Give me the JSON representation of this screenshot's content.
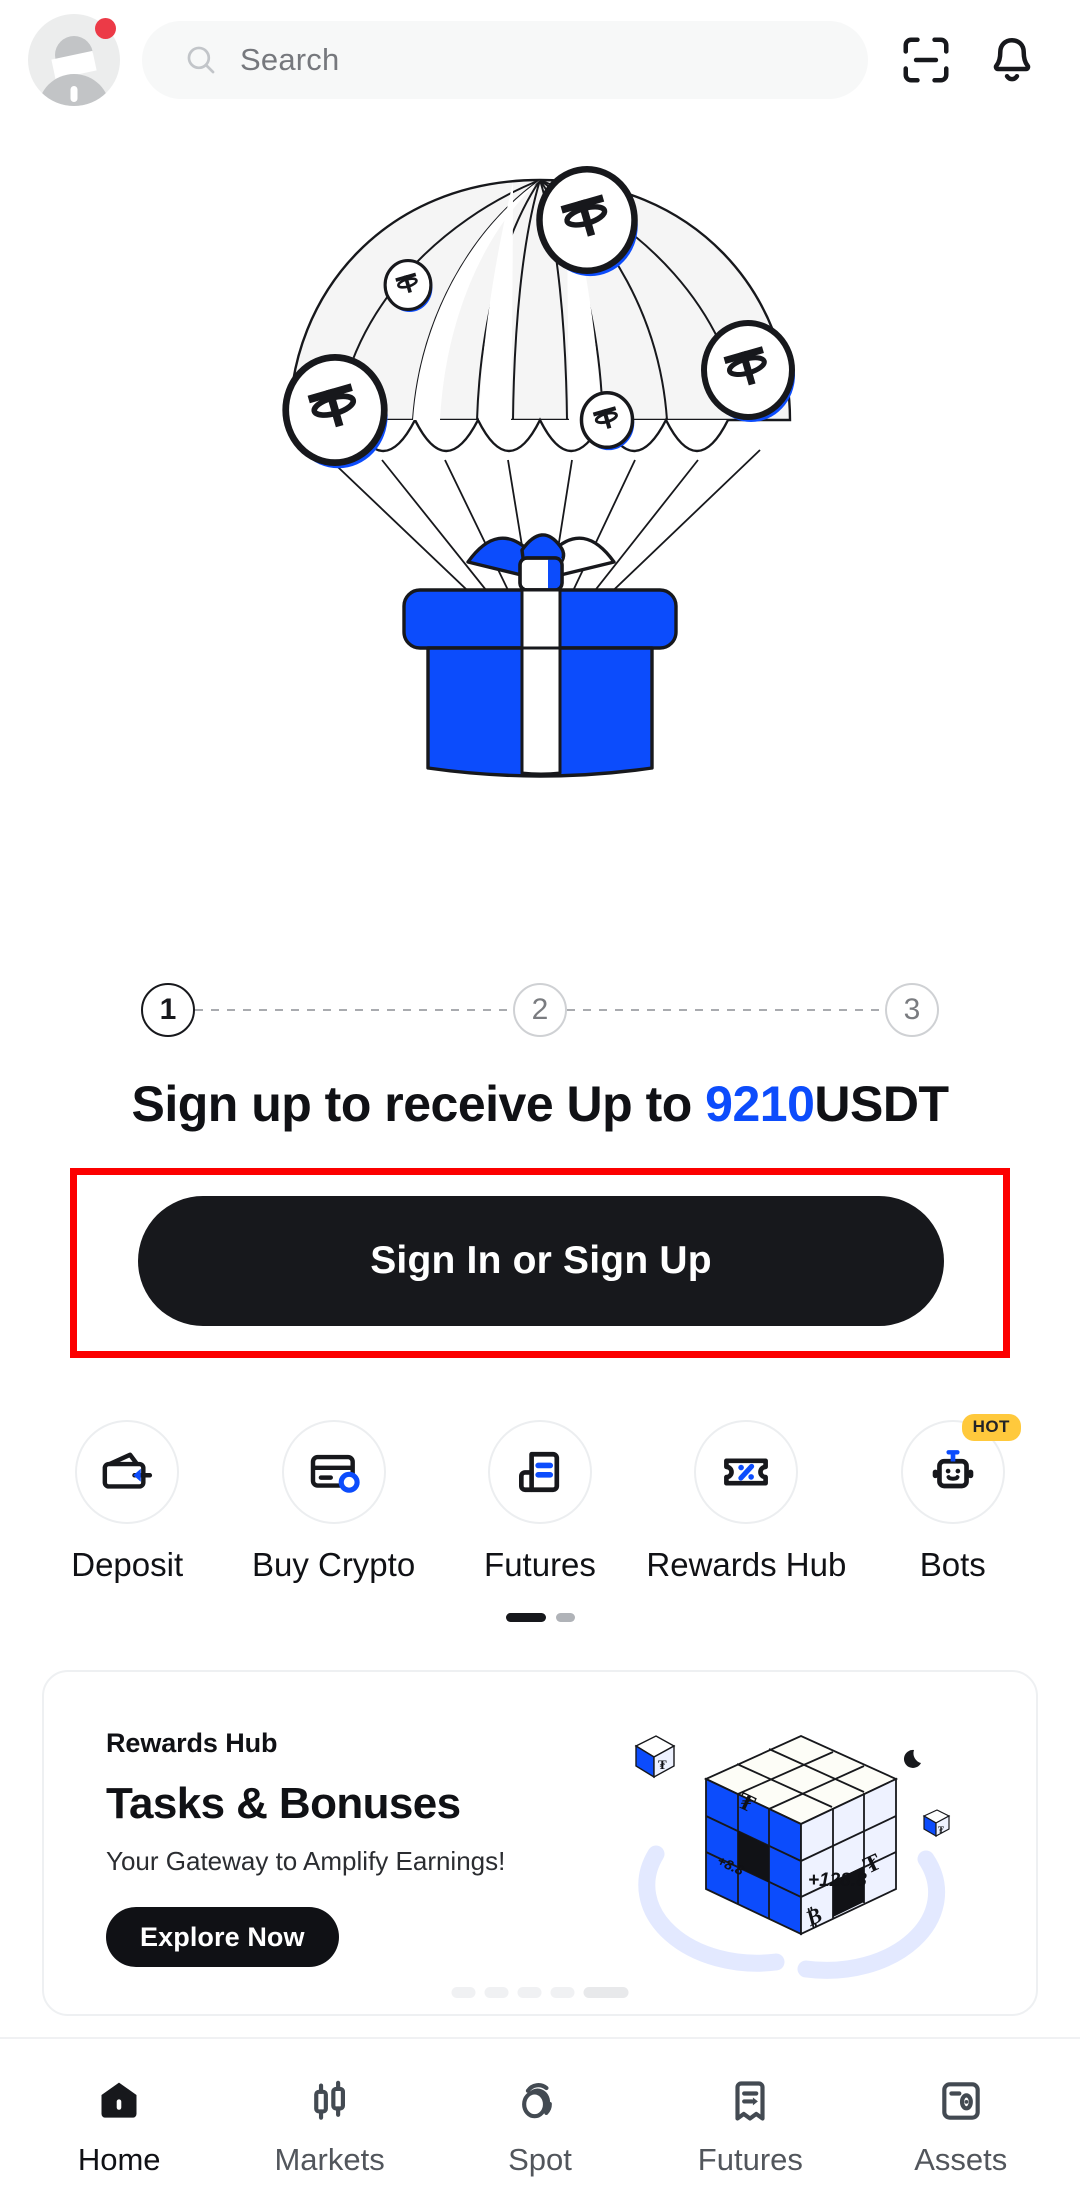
{
  "header": {
    "avatar_name": "user-avatar",
    "notification_dot": true,
    "search_placeholder": "Search",
    "scan_icon": "scan-icon",
    "bell_icon": "notification-bell-icon"
  },
  "hero": {
    "illustration": "parachute-with-gift-box",
    "coin_symbol": "USDT"
  },
  "steps": {
    "items": [
      {
        "label": "1",
        "active": true
      },
      {
        "label": "2",
        "active": false
      },
      {
        "label": "3",
        "active": false
      }
    ]
  },
  "promo": {
    "headline_prefix": "Sign up to receive Up to ",
    "headline_amount": "9210",
    "headline_suffix": "USDT",
    "cta_label": "Sign In or Sign Up",
    "highlight_color": "#fc0000",
    "accent_color": "#0c4cfc"
  },
  "quick_actions": [
    {
      "label": "Deposit",
      "icon": "wallet-deposit-icon",
      "badge": ""
    },
    {
      "label": "Buy Crypto",
      "icon": "credit-card-icon",
      "badge": ""
    },
    {
      "label": "Futures",
      "icon": "futures-document-icon",
      "badge": ""
    },
    {
      "label": "Rewards Hub",
      "icon": "coupon-percent-icon",
      "badge": ""
    },
    {
      "label": "Bots",
      "icon": "robot-icon",
      "badge": "HOT"
    }
  ],
  "quick_actions_pagination": {
    "total": 2,
    "active_index": 0
  },
  "banner": {
    "kicker": "Rewards Hub",
    "title": "Tasks & Bonuses",
    "subtitle": "Your Gateway to Amplify Earnings!",
    "button_label": "Explore Now",
    "art": "rubiks-cube-crypto",
    "art_values": {
      "face_value": "+128.8",
      "side_value": "+8.8"
    },
    "pagination": {
      "total": 5,
      "active_index": 4
    }
  },
  "bottom_nav": [
    {
      "label": "Home",
      "icon": "home-icon",
      "active": true
    },
    {
      "label": "Markets",
      "icon": "candlestick-icon",
      "active": false
    },
    {
      "label": "Spot",
      "icon": "spot-swap-icon",
      "active": false
    },
    {
      "label": "Futures",
      "icon": "futures-icon",
      "active": false
    },
    {
      "label": "Assets",
      "icon": "assets-safe-icon",
      "active": false
    }
  ]
}
